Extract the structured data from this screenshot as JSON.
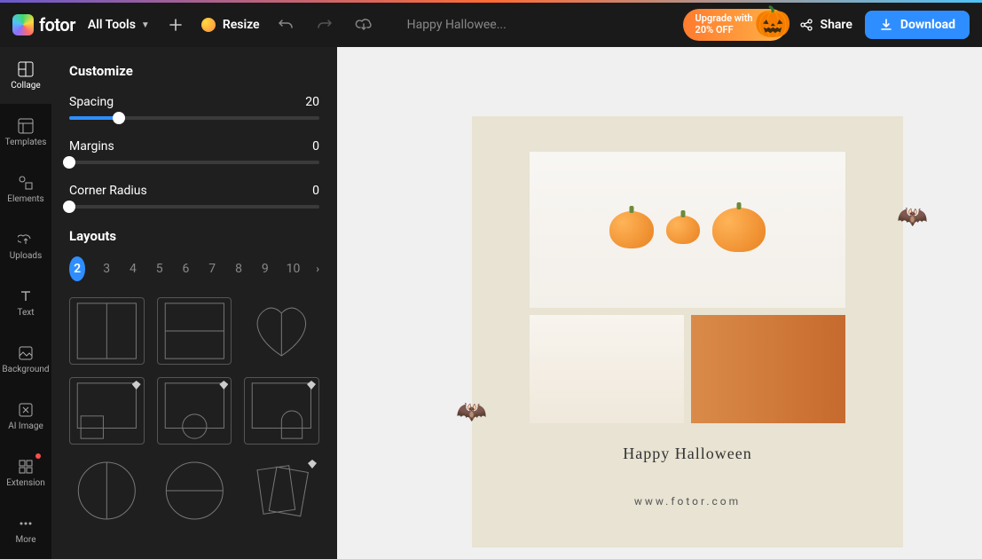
{
  "brand": {
    "name": "fotor"
  },
  "header": {
    "tools_label": "All Tools",
    "resize_label": "Resize",
    "doc_title": "Happy Hallowee...",
    "upgrade_line1": "Upgrade with",
    "upgrade_line2": "20% OFF",
    "share_label": "Share",
    "download_label": "Download"
  },
  "rail": {
    "items": [
      {
        "label": "Collage"
      },
      {
        "label": "Templates"
      },
      {
        "label": "Elements"
      },
      {
        "label": "Uploads"
      },
      {
        "label": "Text"
      },
      {
        "label": "Background"
      },
      {
        "label": "AI Image"
      },
      {
        "label": "Extension"
      },
      {
        "label": "More"
      }
    ]
  },
  "panel": {
    "title": "Customize",
    "spacing": {
      "label": "Spacing",
      "value": "20",
      "percent": 20
    },
    "margins": {
      "label": "Margins",
      "value": "0",
      "percent": 0
    },
    "corner": {
      "label": "Corner Radius",
      "value": "0",
      "percent": 0
    },
    "layouts_title": "Layouts",
    "tabs": [
      "2",
      "3",
      "4",
      "5",
      "6",
      "7",
      "8",
      "9",
      "10"
    ],
    "active_tab": "2"
  },
  "canvas": {
    "caption": "Happy Halloween",
    "url": "www.fotor.com"
  }
}
